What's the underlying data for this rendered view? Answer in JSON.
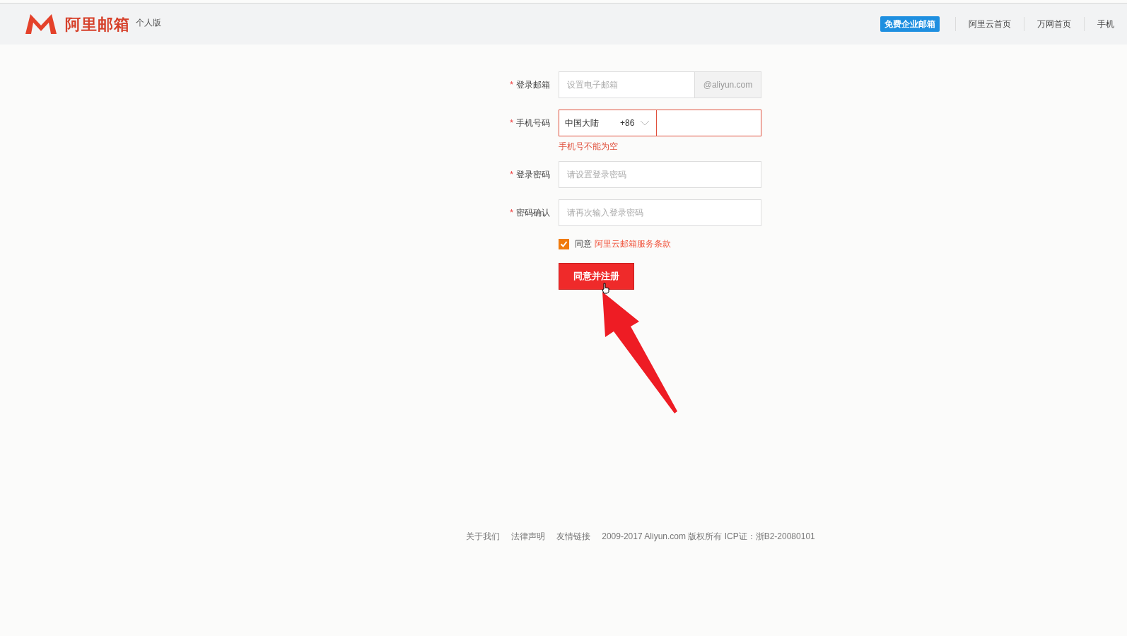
{
  "header": {
    "logo_text": "阿里邮箱",
    "edition": "个人版",
    "nav": [
      {
        "label": "免费企业邮箱",
        "kind": "badge"
      },
      {
        "label": "阿里云首页",
        "kind": "link"
      },
      {
        "label": "万网首页",
        "kind": "link"
      },
      {
        "label": "手机",
        "kind": "link"
      }
    ]
  },
  "form": {
    "fields": [
      {
        "kind": "email",
        "label": "登录邮箱",
        "mark": "*",
        "placeholder": "设置电子邮箱",
        "suffix": "@aliyun.com",
        "invalid": false
      },
      {
        "kind": "phone",
        "label": "手机号码",
        "mark": "*",
        "country": "中国大陆",
        "code": "+86",
        "invalid": true,
        "error": "手机号不能为空"
      },
      {
        "kind": "text",
        "label": "登录密码",
        "mark": "*",
        "placeholder": "请设置登录密码",
        "invalid": false
      },
      {
        "kind": "text",
        "label": "密码确认",
        "mark": "*",
        "placeholder": "请再次输入登录密码",
        "invalid": false
      }
    ],
    "agree": {
      "checked": true,
      "text": "同意",
      "link": "阿里云邮箱服务条款"
    },
    "submit": "同意并注册"
  },
  "footer": {
    "links": [
      "关于我们",
      "法律声明",
      "友情链接"
    ],
    "copyright": "2009-2017 Aliyun.com 版权所有 ICP证：浙B2-20080101"
  }
}
